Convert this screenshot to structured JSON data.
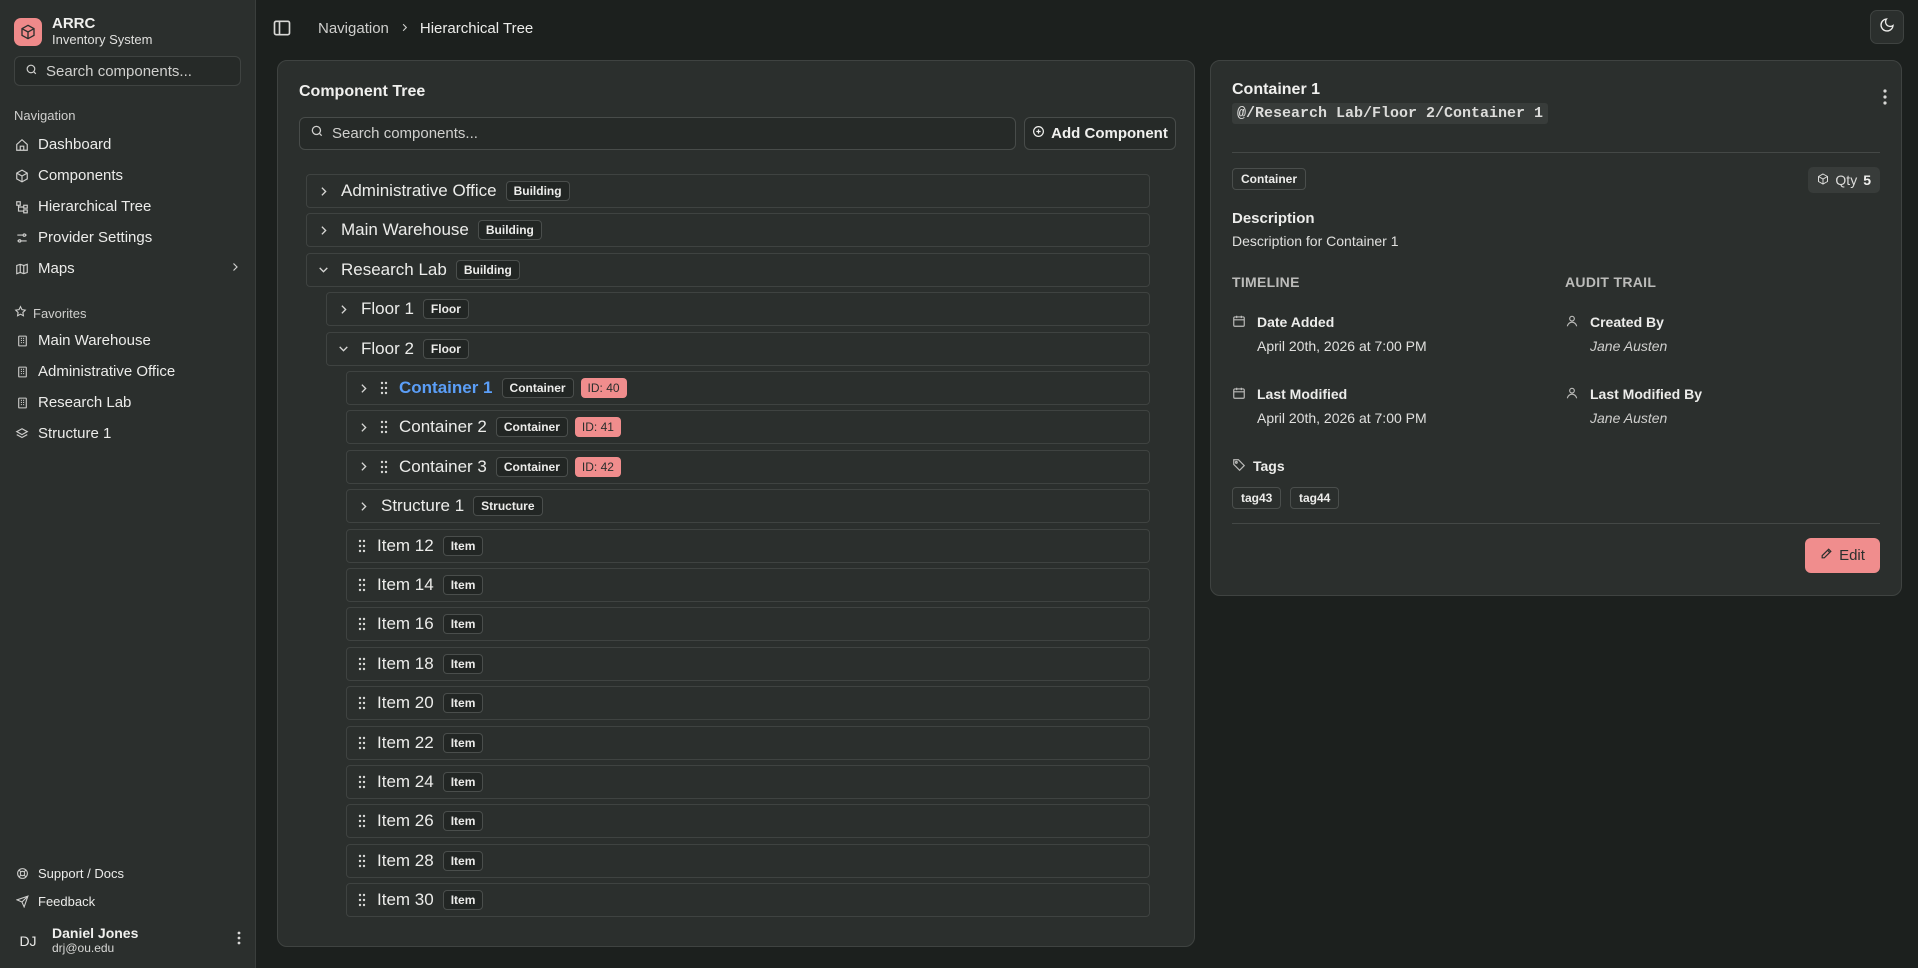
{
  "app": {
    "title": "ARRC",
    "subtitle": "Inventory System"
  },
  "sidebar": {
    "search_placeholder": "Search components...",
    "nav_heading": "Navigation",
    "nav_items": [
      {
        "label": "Dashboard",
        "icon": "home-icon"
      },
      {
        "label": "Components",
        "icon": "box-icon"
      },
      {
        "label": "Hierarchical Tree",
        "icon": "tree-icon"
      },
      {
        "label": "Provider Settings",
        "icon": "sliders-icon"
      },
      {
        "label": "Maps",
        "icon": "map-icon"
      }
    ],
    "favorites_heading": "Favorites",
    "favorites": [
      {
        "label": "Main Warehouse",
        "icon": "building-icon"
      },
      {
        "label": "Administrative Office",
        "icon": "building-icon"
      },
      {
        "label": "Research Lab",
        "icon": "building-icon"
      },
      {
        "label": "Structure 1",
        "icon": "layers-icon"
      }
    ],
    "support": "Support / Docs",
    "feedback": "Feedback",
    "user": {
      "initials": "DJ",
      "name": "Daniel Jones",
      "email": "drj@ou.edu"
    }
  },
  "header": {
    "breadcrumb": [
      "Navigation",
      "Hierarchical Tree"
    ]
  },
  "tree": {
    "title": "Component Tree",
    "search_placeholder": "Search components...",
    "add_label": "Add Component",
    "rows": [
      {
        "name": "Administrative Office",
        "type": "Building",
        "level": 0,
        "state": "collapsed"
      },
      {
        "name": "Main Warehouse",
        "type": "Building",
        "level": 0,
        "state": "collapsed"
      },
      {
        "name": "Research Lab",
        "type": "Building",
        "level": 0,
        "state": "expanded"
      },
      {
        "name": "Floor 1",
        "type": "Floor",
        "level": 1,
        "state": "collapsed"
      },
      {
        "name": "Floor 2",
        "type": "Floor",
        "level": 1,
        "state": "expanded"
      },
      {
        "name": "Container 1",
        "type": "Container",
        "level": 2,
        "state": "collapsed",
        "drag": true,
        "id": "ID: 40",
        "selected": true
      },
      {
        "name": "Container 2",
        "type": "Container",
        "level": 2,
        "state": "collapsed",
        "drag": true,
        "id": "ID: 41"
      },
      {
        "name": "Container 3",
        "type": "Container",
        "level": 2,
        "state": "collapsed",
        "drag": true,
        "id": "ID: 42"
      },
      {
        "name": "Structure 1",
        "type": "Structure",
        "level": 2,
        "state": "collapsed"
      },
      {
        "name": "Item 12",
        "type": "Item",
        "level": 2,
        "state": "leaf",
        "drag": true
      },
      {
        "name": "Item 14",
        "type": "Item",
        "level": 2,
        "state": "leaf",
        "drag": true
      },
      {
        "name": "Item 16",
        "type": "Item",
        "level": 2,
        "state": "leaf",
        "drag": true
      },
      {
        "name": "Item 18",
        "type": "Item",
        "level": 2,
        "state": "leaf",
        "drag": true
      },
      {
        "name": "Item 20",
        "type": "Item",
        "level": 2,
        "state": "leaf",
        "drag": true
      },
      {
        "name": "Item 22",
        "type": "Item",
        "level": 2,
        "state": "leaf",
        "drag": true
      },
      {
        "name": "Item 24",
        "type": "Item",
        "level": 2,
        "state": "leaf",
        "drag": true
      },
      {
        "name": "Item 26",
        "type": "Item",
        "level": 2,
        "state": "leaf",
        "drag": true
      },
      {
        "name": "Item 28",
        "type": "Item",
        "level": 2,
        "state": "leaf",
        "drag": true
      },
      {
        "name": "Item 30",
        "type": "Item",
        "level": 2,
        "state": "leaf",
        "drag": true
      }
    ]
  },
  "detail": {
    "title": "Container 1",
    "path": "@/Research Lab/Floor 2/Container 1",
    "type": "Container",
    "qty_label": "Qty",
    "qty_value": "5",
    "description_label": "Description",
    "description": "Description for Container 1",
    "timeline_heading": "TIMELINE",
    "audit_heading": "AUDIT TRAIL",
    "date_added_label": "Date Added",
    "date_added": "April 20th, 2026 at 7:00 PM",
    "last_modified_label": "Last Modified",
    "last_modified": "April 20th, 2026 at 7:00 PM",
    "created_by_label": "Created By",
    "created_by": "Jane Austen",
    "modified_by_label": "Last Modified By",
    "modified_by": "Jane Austen",
    "tags_label": "Tags",
    "tags": [
      "tag43",
      "tag44"
    ],
    "edit_label": "Edit"
  },
  "colors": {
    "accent": "#f08d8d",
    "selected": "#5b9ef7",
    "background": "#1c201e",
    "panel": "#2b2f2d"
  }
}
